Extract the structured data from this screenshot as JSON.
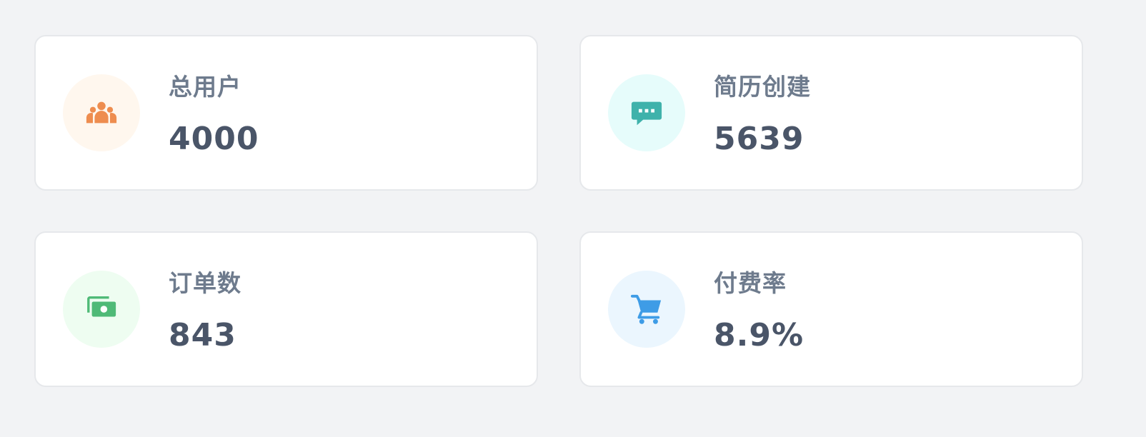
{
  "stats": [
    {
      "label": "总用户",
      "value": "4000",
      "icon": "users-icon",
      "icon_color": "#ee8d4f",
      "icon_bg": "#fff7ee"
    },
    {
      "label": "简历创建",
      "value": "5639",
      "icon": "chat-bubble-icon",
      "icon_color": "#3fb2ab",
      "icon_bg": "#e6fcfb"
    },
    {
      "label": "订单数",
      "value": "843",
      "icon": "money-icon",
      "icon_color": "#4fba77",
      "icon_bg": "#eefdf1"
    },
    {
      "label": "付费率",
      "value": "8.9%",
      "icon": "shopping-cart-icon",
      "icon_color": "#3e9ce6",
      "icon_bg": "#ebf6fe"
    }
  ]
}
